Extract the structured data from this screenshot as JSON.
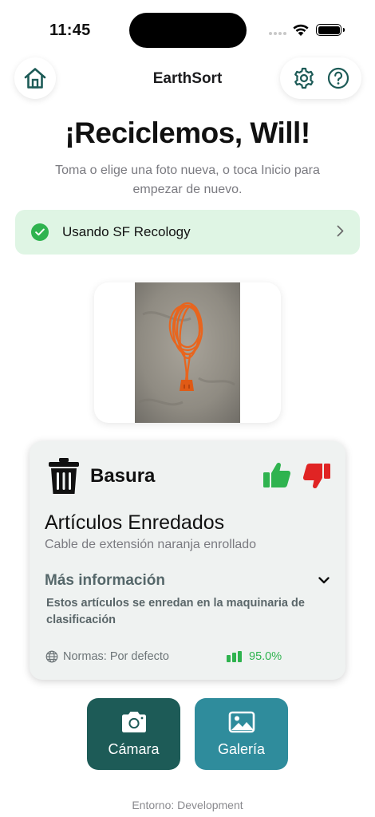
{
  "status_bar": {
    "time": "11:45"
  },
  "nav": {
    "title": "EarthSort",
    "home_icon": "home-icon",
    "settings_icon": "gear-icon",
    "help_icon": "question-circle-icon"
  },
  "headline": "¡Reciclemos, Will!",
  "subtitle": "Toma o elige una foto nueva, o toca Inicio para empezar de nuevo.",
  "provider": {
    "label": "Usando SF Recology",
    "status_color": "#2fb34f",
    "background": "#dff5e4"
  },
  "photo": {
    "subject": "orange extension cord coiled on concrete"
  },
  "result": {
    "category": "Basura",
    "category_icon": "trash-bin-icon",
    "item_title": "Artículos Enredados",
    "item_description": "Cable de extensión naranja enrollado",
    "more_info_label": "Más información",
    "more_info_text": "Estos artículos se enredan en la maquinaria de clasificación",
    "norms_label": "Normas: Por defecto",
    "confidence": "95.0%",
    "confidence_value": 0.95,
    "feedback": {
      "up_color": "#2fb34f",
      "down_color": "#e02424"
    }
  },
  "actions": {
    "camera_label": "Cámara",
    "gallery_label": "Galería",
    "camera_color": "#1d5b57",
    "gallery_color": "#2f8c9c"
  },
  "footer": {
    "environment": "Entorno: Development"
  }
}
